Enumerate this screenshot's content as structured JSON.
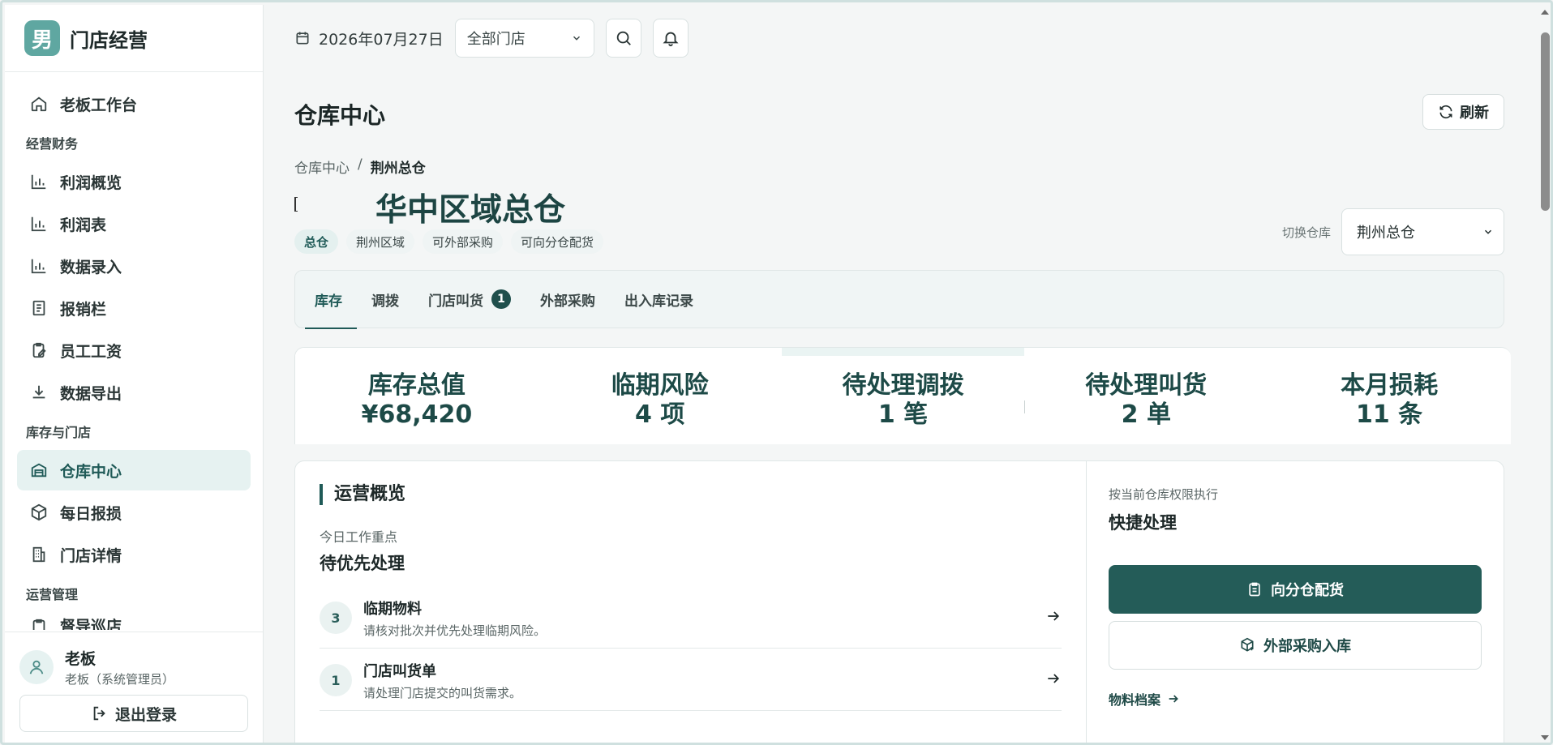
{
  "brand": {
    "logo_char": "男",
    "title": "门店经营"
  },
  "sidebar": {
    "items": [
      {
        "label": "老板工作台",
        "icon": "home-icon"
      },
      {
        "group": "经营财务"
      },
      {
        "label": "利润概览",
        "icon": "bar-chart-icon"
      },
      {
        "label": "利润表",
        "icon": "bar-chart-icon"
      },
      {
        "label": "数据录入",
        "icon": "bar-chart-icon"
      },
      {
        "label": "报销栏",
        "icon": "receipt-icon"
      },
      {
        "label": "员工工资",
        "icon": "clipboard-edit-icon"
      },
      {
        "label": "数据导出",
        "icon": "download-icon"
      },
      {
        "group": "库存与门店"
      },
      {
        "label": "仓库中心",
        "icon": "warehouse-icon",
        "active": true
      },
      {
        "label": "每日报损",
        "icon": "box-icon"
      },
      {
        "label": "门店详情",
        "icon": "building-icon"
      },
      {
        "group": "运营管理"
      },
      {
        "label": "督导巡店",
        "icon": "clipboard-icon"
      }
    ]
  },
  "user": {
    "name": "老板",
    "role": "老板（系统管理员）",
    "logout_label": "退出登录"
  },
  "topbar": {
    "date": "2026年07月27日",
    "store_select": "全部门店"
  },
  "page": {
    "title": "仓库中心",
    "refresh_label": "刷新",
    "breadcrumb": {
      "root": "仓库中心",
      "separator": "/",
      "current": "荆州总仓"
    },
    "warehouse_title": "华中区域总仓",
    "tags": [
      "总仓",
      "荆州区域",
      "可外部采购",
      "可向分仓配货"
    ],
    "switch_label": "切换仓库",
    "switch_value": "荆州总仓"
  },
  "tabs": [
    {
      "label": "库存",
      "active": true
    },
    {
      "label": "调拨"
    },
    {
      "label": "门店叫货",
      "badge": "1"
    },
    {
      "label": "外部采购"
    },
    {
      "label": "出入库记录"
    }
  ],
  "kpis": [
    {
      "label": "库存总值",
      "value": "¥68,420"
    },
    {
      "label": "临期风险",
      "value": "4 项"
    },
    {
      "label": "待处理调拨",
      "value": "1 笔"
    },
    {
      "label": "待处理叫货",
      "value": "2 单"
    },
    {
      "label": "本月损耗",
      "value": "11 条"
    }
  ],
  "overview": {
    "title": "运营概览",
    "hint": "今日工作重点",
    "subtitle": "待优先处理",
    "todos": [
      {
        "count": "3",
        "title": "临期物料",
        "desc": "请核对批次并优先处理临期风险。"
      },
      {
        "count": "1",
        "title": "门店叫货单",
        "desc": "请处理门店提交的叫货需求。"
      }
    ]
  },
  "quick": {
    "hint": "按当前仓库权限执行",
    "title": "快捷处理",
    "primary_label": "向分仓配货",
    "secondary_label": "外部采购入库",
    "link_label": "物料档案"
  },
  "colors": {
    "accent": "#245c58",
    "brand": "#5fa7a1",
    "active_bg": "#e6f2f1"
  }
}
